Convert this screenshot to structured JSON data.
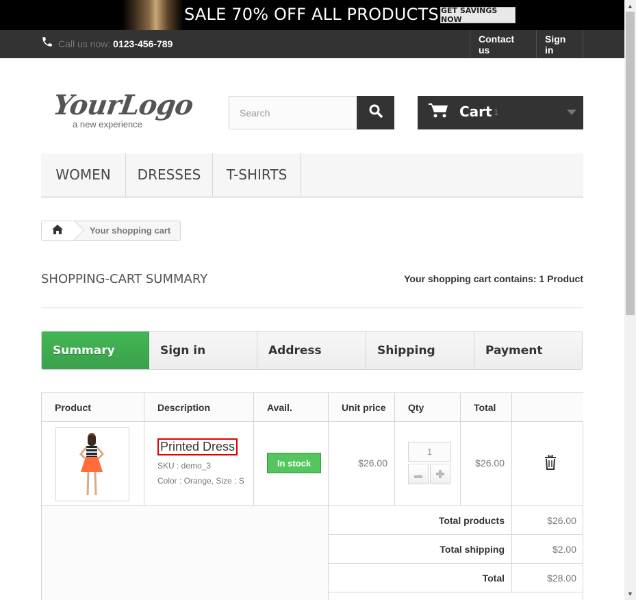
{
  "promo": {
    "headline": "SALE 70% OFF ALL PRODUCTS",
    "cta": "GET SAVINGS NOW"
  },
  "header": {
    "call_label": "Call us now: ",
    "phone": "0123-456-789",
    "contact_label": "Contact us",
    "signin_label": "Sign in"
  },
  "logo": {
    "main": "YourLogo",
    "tagline": "a new experience"
  },
  "search": {
    "placeholder": "Search",
    "value": ""
  },
  "cart": {
    "label": "Cart",
    "count": "1"
  },
  "menu": {
    "items": [
      "WOMEN",
      "DRESSES",
      "T-SHIRTS"
    ]
  },
  "breadcrumb": {
    "current": "Your shopping cart"
  },
  "page": {
    "title": "SHOPPING-CART SUMMARY",
    "contains": "Your shopping cart contains: 1 Product"
  },
  "steps": [
    "Summary",
    "Sign in",
    "Address",
    "Shipping",
    "Payment"
  ],
  "table": {
    "headers": [
      "Product",
      "Description",
      "Avail.",
      "Unit price",
      "Qty",
      "Total",
      ""
    ],
    "rows": [
      {
        "name": "Printed Dress",
        "sku": "SKU : demo_3",
        "attributes": "Color : Orange, Size : S",
        "availability": "In stock",
        "unit_price": "$26.00",
        "qty": "1",
        "total": "$26.00"
      }
    ],
    "summary": [
      {
        "label": "Total products",
        "value": "$26.00"
      },
      {
        "label": "Total shipping",
        "value": "$2.00"
      },
      {
        "label": "Total",
        "value": "$28.00"
      }
    ]
  },
  "colors": {
    "accent_green": "#43b754",
    "dark": "#333333",
    "highlight_red": "#dd0000"
  },
  "icons": [
    "phone-icon",
    "search-icon",
    "cart-icon",
    "chevron-down-icon",
    "home-icon",
    "trash-icon",
    "minus-icon",
    "plus-icon"
  ]
}
